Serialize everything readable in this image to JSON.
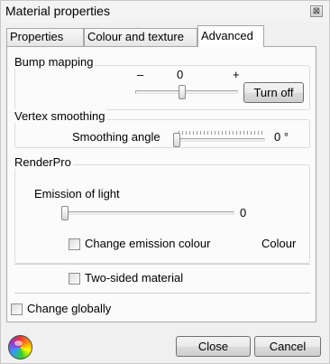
{
  "window": {
    "title": "Material properties",
    "close_glyph": "⊠",
    "icons": {
      "close": "close-icon",
      "app": "color-wheel-icon"
    }
  },
  "tabs": [
    {
      "label": "Properties",
      "active": false
    },
    {
      "label": "Colour and texture",
      "active": false
    },
    {
      "label": "Advanced",
      "active": true
    }
  ],
  "bump_mapping": {
    "legend": "Bump mapping",
    "minus": "–",
    "value": "0",
    "plus": "+",
    "level": 0.5,
    "button": "Turn off"
  },
  "vertex_smoothing": {
    "legend": "Vertex smoothing",
    "label": "Smoothing angle",
    "value": "0 °",
    "level": 0
  },
  "renderpro": {
    "legend": "RenderPro",
    "emission_label": "Emission of light",
    "emission_value": "0",
    "emission_level": 0,
    "change_emission_label": "Change emission colour",
    "change_emission_checked": false,
    "colour_button": "Colour",
    "two_sided_label": "Two-sided material",
    "two_sided_checked": false
  },
  "change_globally": {
    "label": "Change globally",
    "checked": false
  },
  "footer": {
    "close": "Close",
    "cancel": "Cancel"
  }
}
